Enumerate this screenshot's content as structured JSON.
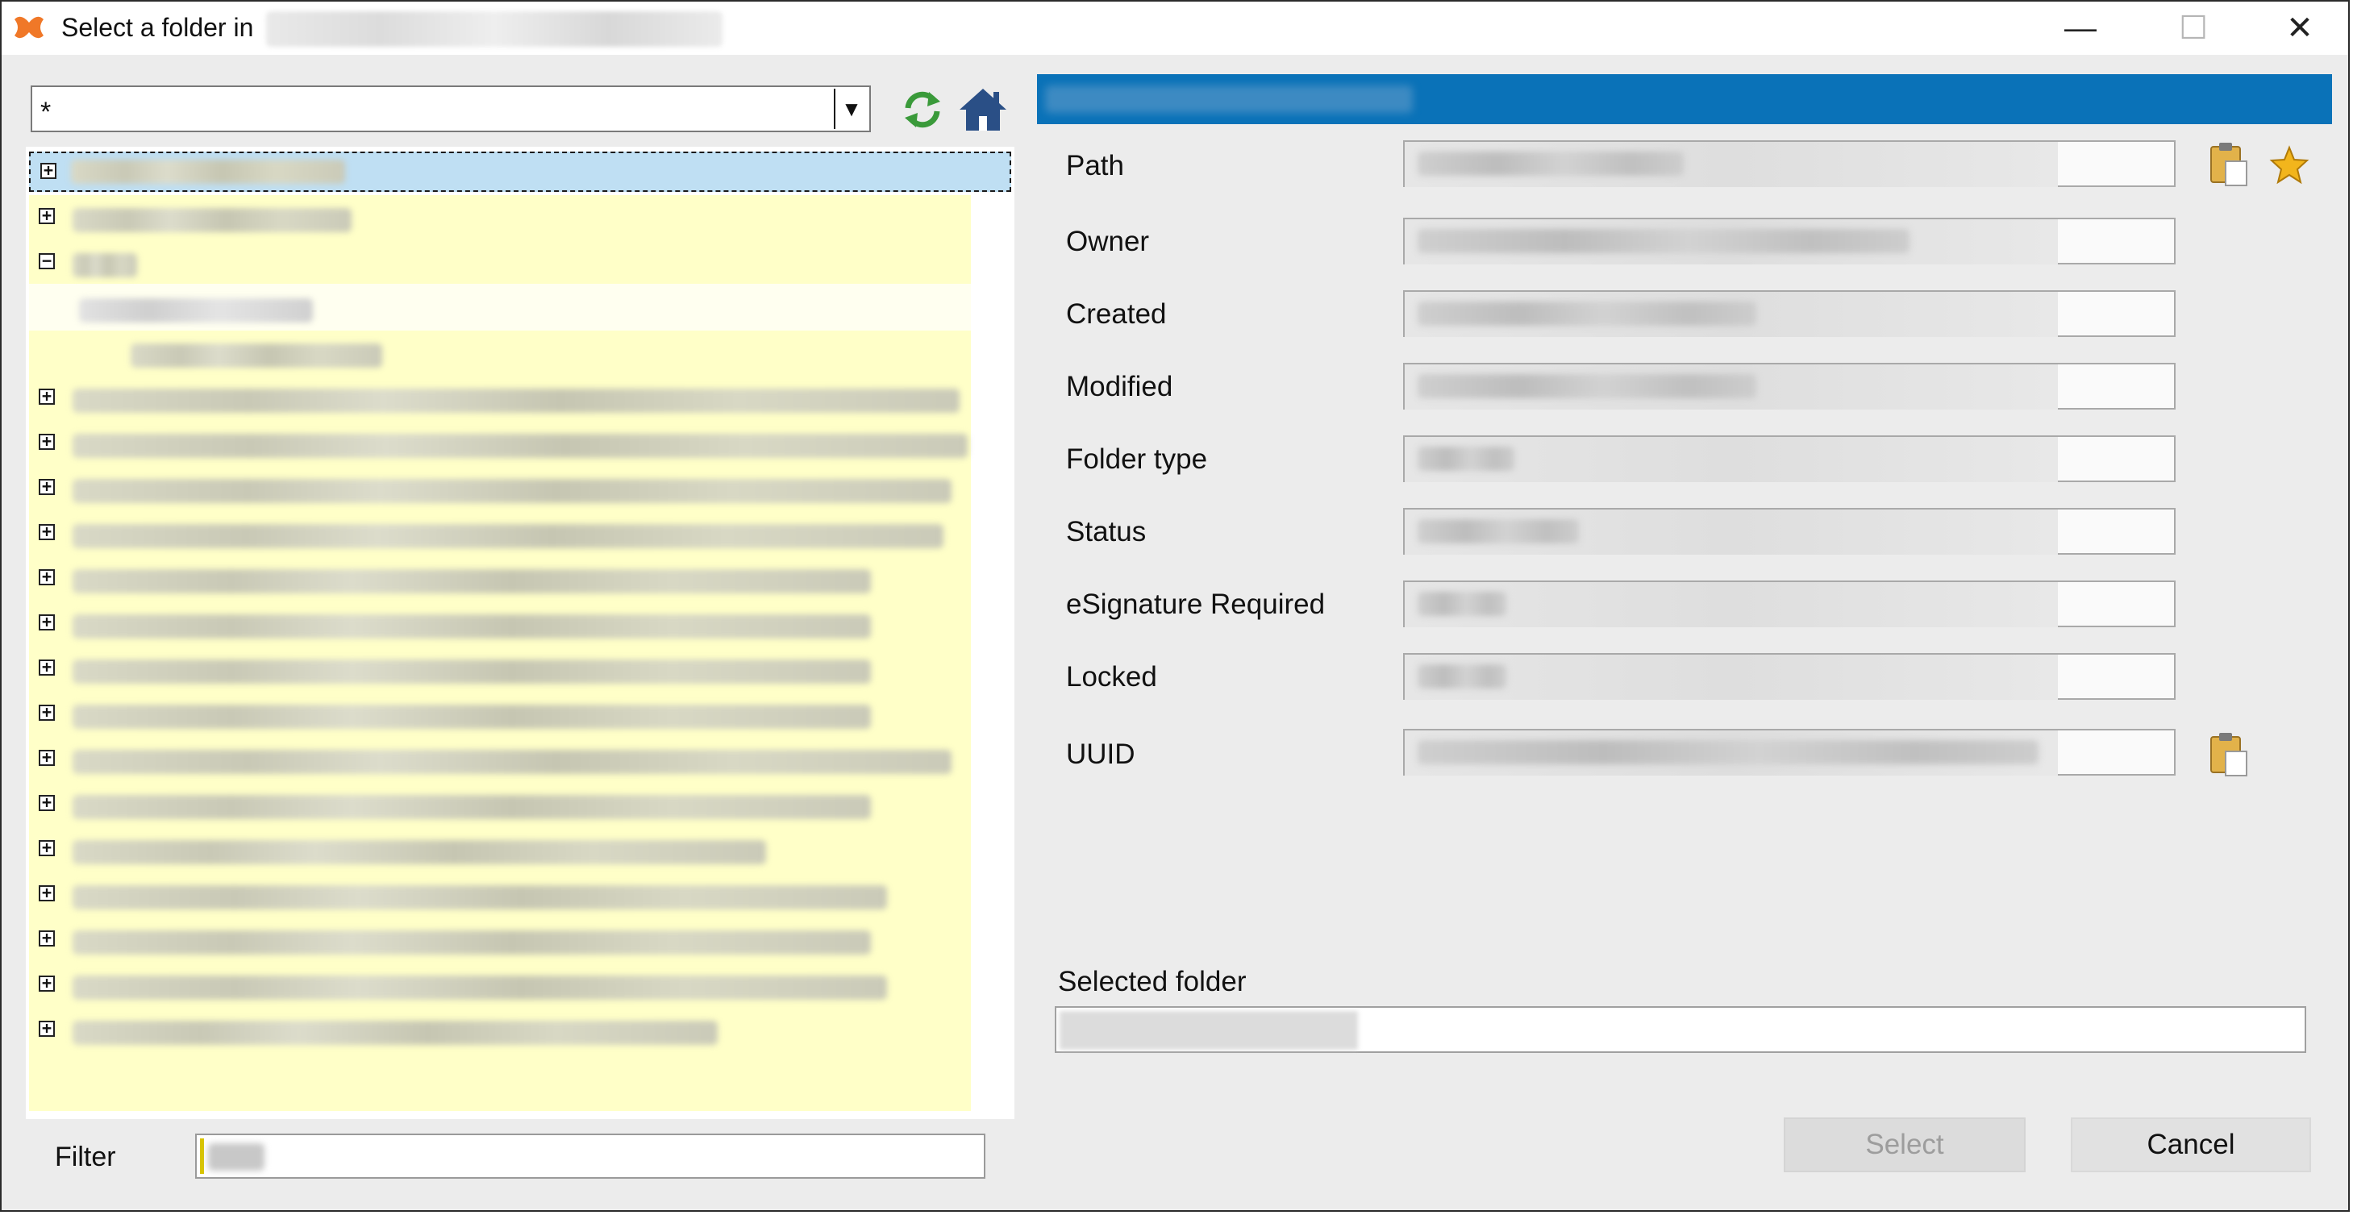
{
  "window": {
    "title": "Select a folder in",
    "controls": {
      "minimize": "—",
      "maximize": "☐",
      "close": "✕"
    }
  },
  "toolbar": {
    "combo_value": "*",
    "combo_arrow": "▼",
    "icons": [
      "refresh-icon",
      "home-icon"
    ]
  },
  "tree": {
    "expand_symbol": "+",
    "collapse_symbol": "−"
  },
  "filter": {
    "label": "Filter"
  },
  "properties": {
    "labels": [
      "Path",
      "Owner",
      "Created",
      "Modified",
      "Folder type",
      "Status",
      "eSignature Required",
      "Locked",
      "UUID"
    ]
  },
  "selected_folder": {
    "label": "Selected folder"
  },
  "buttons": {
    "select": "Select",
    "cancel": "Cancel"
  },
  "colors": {
    "header_band": "#0a72b8",
    "tree_highlight": "#ffffc8",
    "selection": "#bfdff3",
    "app_icon": "#f07828"
  }
}
